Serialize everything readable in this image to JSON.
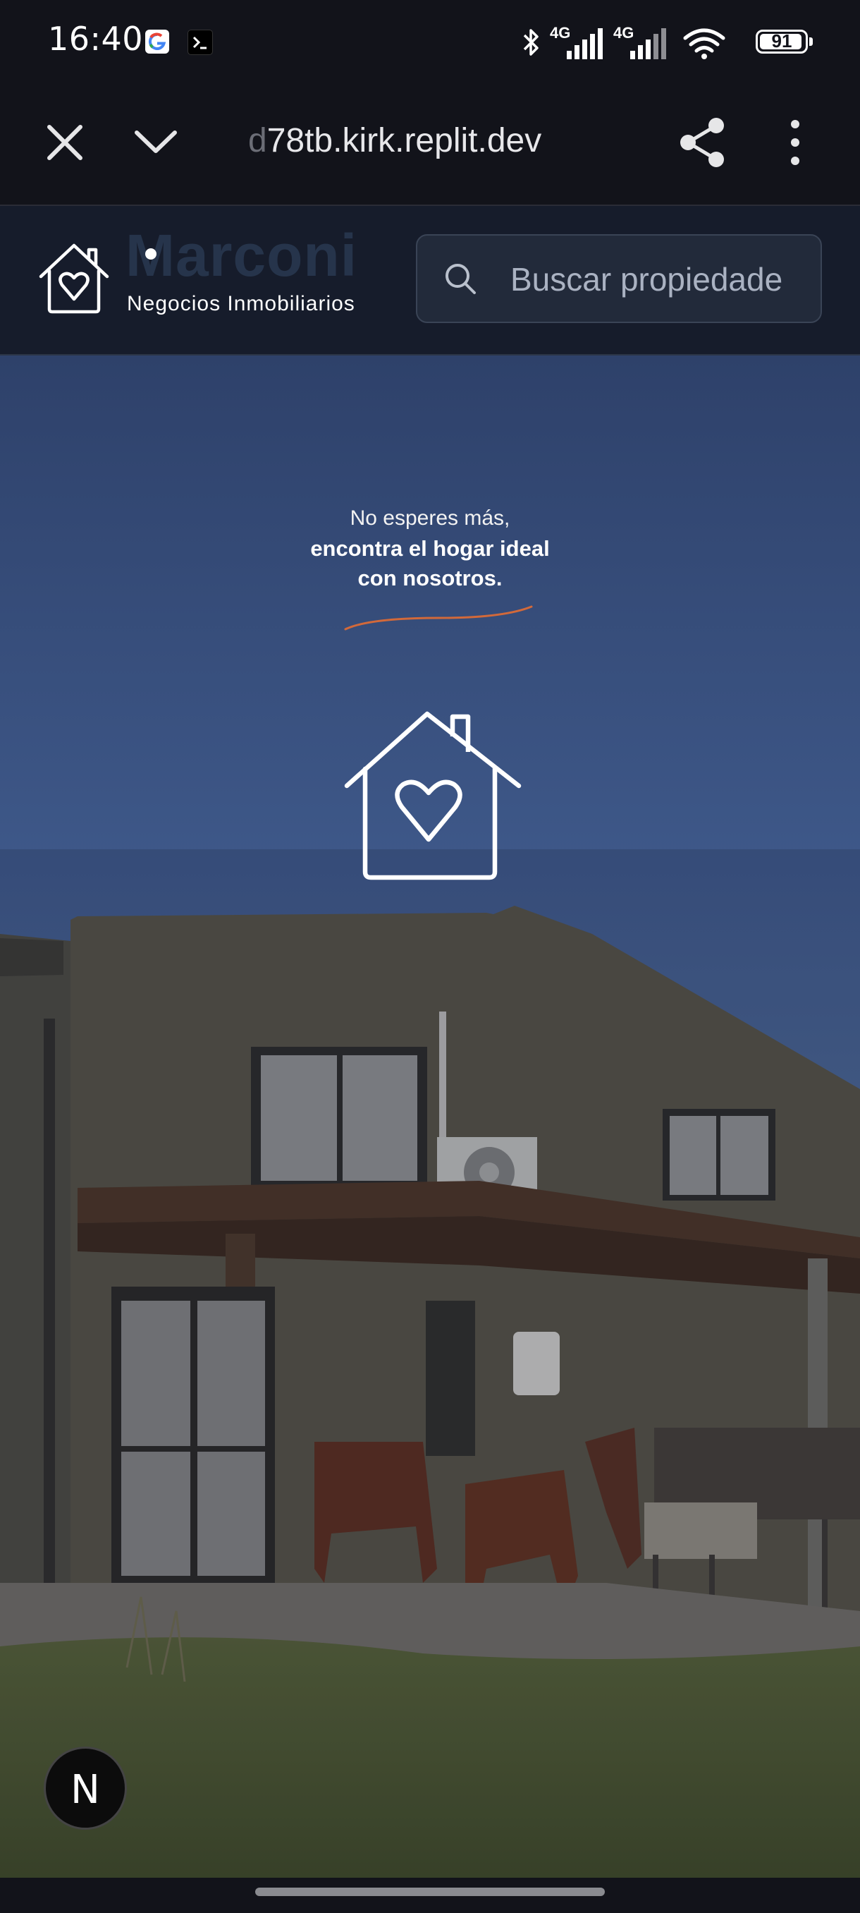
{
  "status_bar": {
    "time": "16:40",
    "network_1": "4G",
    "network_2": "4G",
    "battery": "91",
    "icons": [
      "google-icon",
      "terminal-icon",
      "bluetooth-icon",
      "signal-icon",
      "signal-icon",
      "wifi-icon",
      "battery-icon"
    ]
  },
  "browser": {
    "url_fade": "d",
    "url": "78tb.kirk.replit.dev",
    "icons": [
      "close-icon",
      "chevron-down-icon",
      "share-icon",
      "more-vertical-icon"
    ]
  },
  "header": {
    "brand": "Marconi",
    "tagline": "Negocios Inmobiliarios",
    "search_placeholder": "Buscar propiedade",
    "colors": {
      "header_bg": "#161c2b",
      "brand_text": "#26344b"
    }
  },
  "hero": {
    "line1": "No esperes más,",
    "line2": "encontra el hogar ideal",
    "line3": "con nosotros.",
    "accent_color": "#d2693a"
  },
  "badge": {
    "label": "N"
  }
}
